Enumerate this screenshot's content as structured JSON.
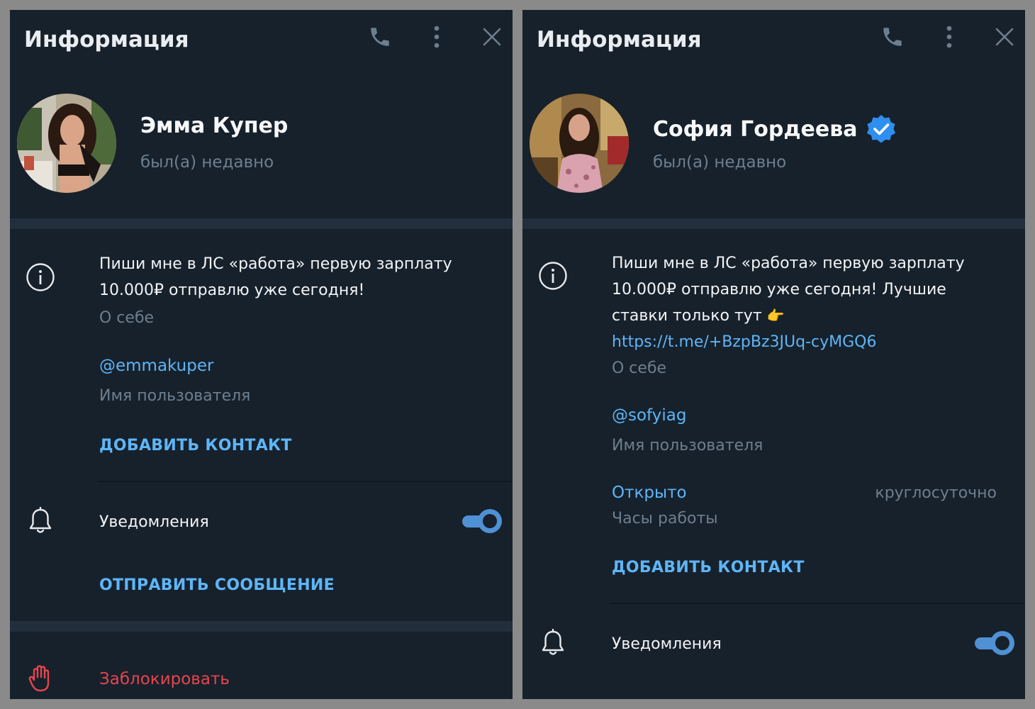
{
  "left": {
    "header": {
      "title": "Информация"
    },
    "profile": {
      "name": "Эмма Купер",
      "status": "был(а) недавно"
    },
    "bio": {
      "text": "Пиши мне в ЛС «работа» первую зарплату 10.000₽ отправлю уже сегодня!",
      "label": "О себе"
    },
    "username": {
      "value": "@emmakuper",
      "label": "Имя пользователя"
    },
    "add_contact": "ДОБАВИТЬ КОНТАКТ",
    "notifications": {
      "label": "Уведомления",
      "enabled": true
    },
    "send_message": "ОТПРАВИТЬ СООБЩЕНИЕ",
    "block": "Заблокировать"
  },
  "right": {
    "header": {
      "title": "Информация"
    },
    "profile": {
      "name": "София Гордеева",
      "status": "был(а) недавно",
      "verified": true
    },
    "bio": {
      "text": "Пиши мне в ЛС «работа» первую зарплату 10.000₽ отправлю уже сегодня! Лучшие ставки только тут",
      "emoji": "👉",
      "link": "https://t.me/+BzpBz3JUq-cyMGQ6",
      "label": "О себе"
    },
    "username": {
      "value": "@sofyiag",
      "label": "Имя пользователя"
    },
    "hours": {
      "status": "Открыто",
      "value": "круглосуточно",
      "label": "Часы работы"
    },
    "add_contact": "ДОБАВИТЬ КОНТАКТ",
    "notifications": {
      "label": "Уведомления",
      "enabled": true
    }
  },
  "colors": {
    "panel_bg": "#17212b",
    "separator": "#232e3c",
    "accent": "#5eb5f7",
    "secondary_text": "#6d7f8f",
    "danger": "#e5454e",
    "toggle": "#4f91d4",
    "verified": "#2f8ff0"
  },
  "icons": [
    "phone-icon",
    "more-vertical-icon",
    "close-icon",
    "info-icon",
    "bell-icon",
    "hand-stop-icon",
    "verified-badge-icon"
  ]
}
